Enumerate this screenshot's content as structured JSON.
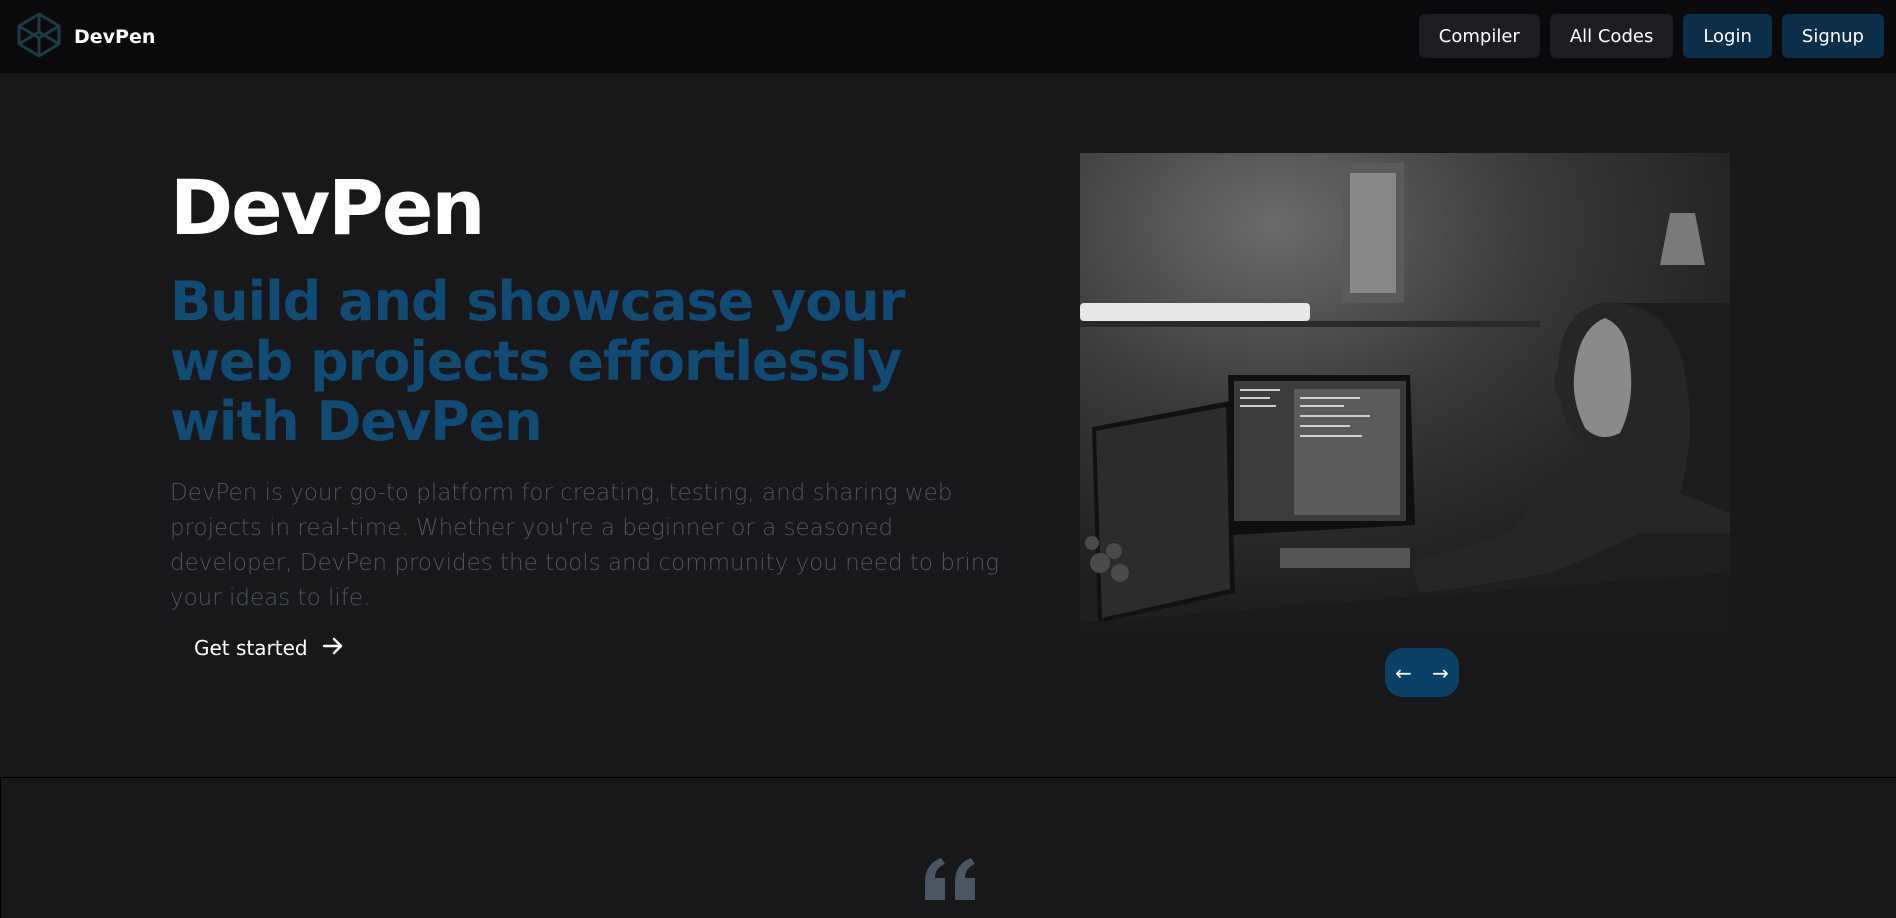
{
  "navbar": {
    "brand": "DevPen",
    "logo_icon": "codepen-logo-icon",
    "buttons": [
      "Compiler",
      "All Codes",
      "Login",
      "Signup"
    ]
  },
  "hero": {
    "title": "DevPen",
    "subtitle": "Build and showcase your web projects effortlessly with DevPen",
    "description": "DevPen is your go-to platform for creating, testing, and sharing web projects in real-time. Whether you're a beginner or a seasoned developer, DevPen provides the tools and community you need to bring your ideas to life.",
    "cta": "Get started",
    "cta_icon": "arrow-right-icon"
  },
  "carousel": {
    "prev": "←",
    "next": "→"
  },
  "testimonial": {
    "quote_icon": "quote-icon"
  },
  "colors": {
    "background": "#18181b",
    "navbar": "#0a0a0c",
    "accent": "#0f4b73",
    "button_dark": "#1e1e22",
    "button_primary": "#0b2e4a"
  }
}
